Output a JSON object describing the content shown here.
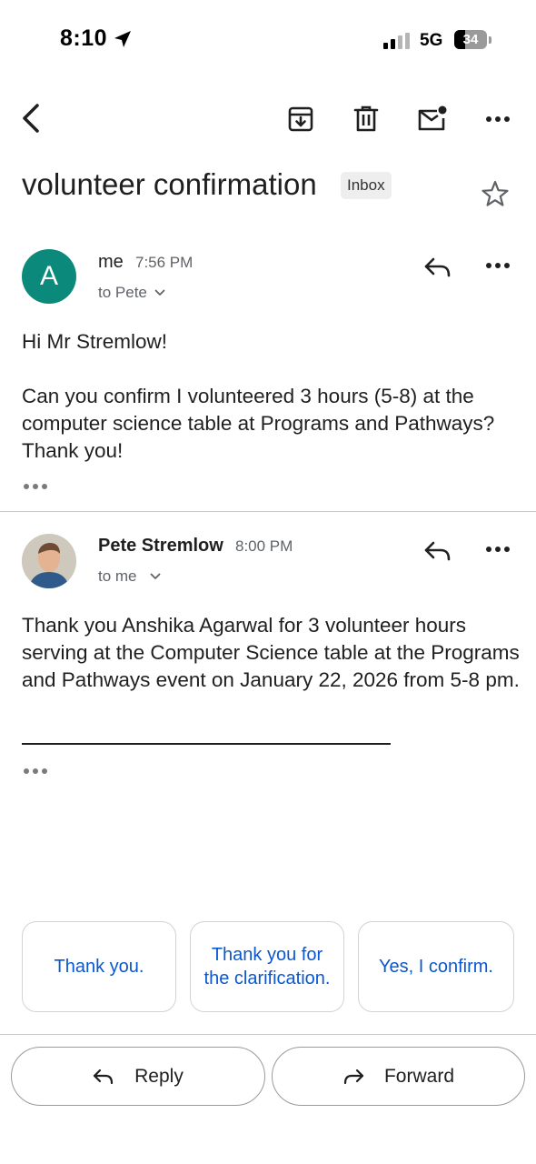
{
  "status_bar": {
    "time": "8:10",
    "network": "5G",
    "battery_level": "34",
    "battery_fraction": 0.34
  },
  "toolbar": {
    "icons": [
      "back-arrow-icon",
      "archive-icon",
      "trash-icon",
      "mark-unread-icon",
      "more-horizontal-icon"
    ]
  },
  "email": {
    "subject": "volunteer confirmation",
    "label": "Inbox",
    "star_icon": "star-outline-icon"
  },
  "messages": [
    {
      "avatar_letter": "A",
      "avatar_color": "#0b8a7c",
      "sender": "me",
      "time": "7:56 PM",
      "recipient": "to Pete",
      "greeting": "Hi Mr Stremlow!",
      "body": "Can you confirm I volunteered 3 hours (5-8) at the computer science table at Programs and Pathways? Thank you!"
    },
    {
      "sender": "Pete Stremlow",
      "time": "8:00 PM",
      "recipient": "to me",
      "body": "Thank you Anshika Agarwal for 3 volunteer hours serving at the Computer Science table at the Programs and Pathways event on January 22, 2026 from 5-8 pm."
    }
  ],
  "smart_replies": [
    "Thank you.",
    "Thank you for the clarification.",
    "Yes, I confirm."
  ],
  "actions": {
    "reply": "Reply",
    "forward": "Forward"
  },
  "colors": {
    "accent_blue": "#0b57d0",
    "text": "#1f1f1f",
    "secondary_text": "#5f6368"
  }
}
